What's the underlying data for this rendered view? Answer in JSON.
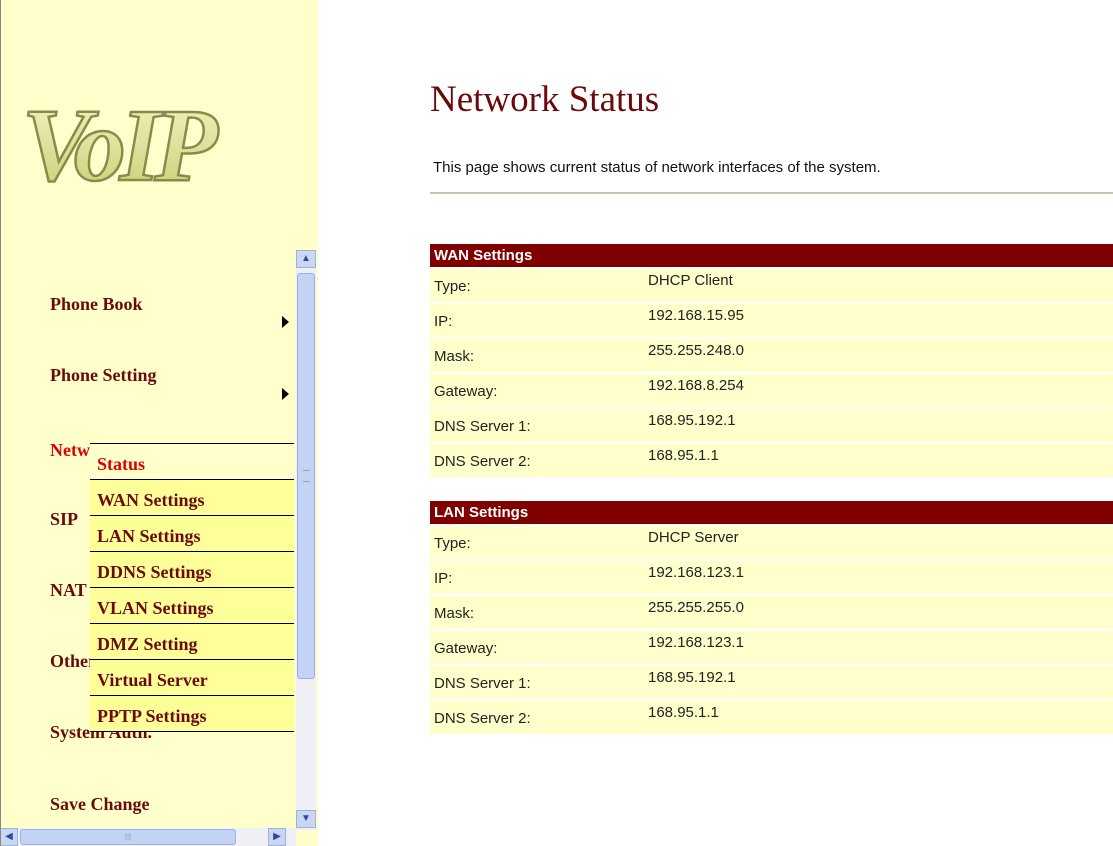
{
  "sidebar": {
    "logo_text": "VoIP",
    "items": [
      {
        "label": "Phone Book",
        "has_submenu": true
      },
      {
        "label": "Phone Setting",
        "has_submenu": true
      },
      {
        "label": "Network",
        "has_submenu": true,
        "active": true
      },
      {
        "label": "SIP"
      },
      {
        "label": "NAT"
      },
      {
        "label": "Other"
      },
      {
        "label": "System Auth."
      },
      {
        "label": "Save Change"
      }
    ]
  },
  "submenu": {
    "items": [
      {
        "label": "Status",
        "active": true
      },
      {
        "label": "WAN Settings"
      },
      {
        "label": "LAN Settings"
      },
      {
        "label": "DDNS Settings"
      },
      {
        "label": "VLAN Settings"
      },
      {
        "label": "DMZ Setting"
      },
      {
        "label": "Virtual Server"
      },
      {
        "label": "PPTP Settings"
      }
    ]
  },
  "main": {
    "title": "Network Status",
    "description": "This page shows current status of network interfaces of the system.",
    "wan": {
      "header": "WAN Settings",
      "rows": [
        {
          "label": "Type:",
          "value": "DHCP Client"
        },
        {
          "label": "IP:",
          "value": "192.168.15.95"
        },
        {
          "label": "Mask:",
          "value": "255.255.248.0"
        },
        {
          "label": "Gateway:",
          "value": "192.168.8.254"
        },
        {
          "label": "DNS Server 1:",
          "value": "168.95.192.1"
        },
        {
          "label": "DNS Server 2:",
          "value": "168.95.1.1"
        }
      ]
    },
    "lan": {
      "header": "LAN Settings",
      "rows": [
        {
          "label": "Type:",
          "value": "DHCP Server"
        },
        {
          "label": "IP:",
          "value": "192.168.123.1"
        },
        {
          "label": "Mask:",
          "value": "255.255.255.0"
        },
        {
          "label": "Gateway:",
          "value": "192.168.123.1"
        },
        {
          "label": "DNS Server 1:",
          "value": "168.95.192.1"
        },
        {
          "label": "DNS Server 2:",
          "value": "168.95.1.1"
        }
      ]
    }
  },
  "colors": {
    "accent": "#800000",
    "panel": "#ffffcc",
    "active_text": "#e00000"
  }
}
